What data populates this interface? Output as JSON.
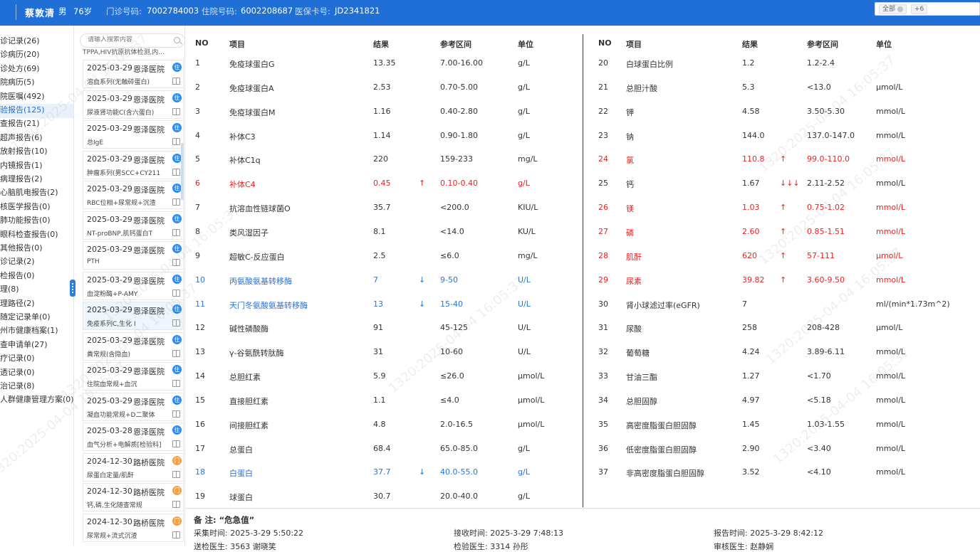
{
  "header": {
    "name": "蔡敦清",
    "gender": "男",
    "age": "76岁",
    "outpatient_label": "门诊号码:",
    "outpatient_no": "7002784003",
    "inpatient_label": "住院号码:",
    "inpatient_no": "6002208687",
    "insurance_label": "医保卡号:",
    "insurance_no": "JD2341821",
    "filter_chip": "全部",
    "filter_more": "+6"
  },
  "leftnav": [
    "诊记录(26)",
    "诊病历(20)",
    "诊处方(69)",
    "院病历(5)",
    "院医嘱(492)",
    "验报告(125)",
    "查报告(21)",
    "超声报告(6)",
    "放射报告(10)",
    "内镜报告(1)",
    "病理报告(2)",
    "心脑肌电报告(2)",
    "核医学报告(0)",
    "肺功能报告(0)",
    "眼科检查报告(0)",
    "其他报告(0)",
    "诊记录(2)",
    "检报告(0)",
    "理(8)",
    "理路径(2)",
    "随定记录单(0)",
    "州市健康档案(1)",
    "查申请单(27)",
    "疗记录(0)",
    "透记录(0)",
    "治记录(8)",
    "人群健康管理方案(0)"
  ],
  "search": {
    "placeholder": "请输入搜索内容"
  },
  "truncated_desc": "TPPA,HIV抗原抗体检测,内...",
  "records": [
    {
      "date": "2025-03-29",
      "hospital": "恩泽医院",
      "type": "住",
      "desc": "溶血系列(无触碎蛋白)"
    },
    {
      "date": "2025-03-29",
      "hospital": "恩泽医院",
      "type": "住",
      "desc": "尿液肾功能C(含六蛋白)"
    },
    {
      "date": "2025-03-29",
      "hospital": "恩泽医院",
      "type": "住",
      "desc": "总IgE"
    },
    {
      "date": "2025-03-29",
      "hospital": "恩泽医院",
      "type": "住",
      "desc": "肿瘤系列(男SCC+CY211"
    },
    {
      "date": "2025-03-29",
      "hospital": "恩泽医院",
      "type": "住",
      "desc": "RBC位相+尿常规+沉渣"
    },
    {
      "date": "2025-03-29",
      "hospital": "恩泽医院",
      "type": "住",
      "desc": "NT-proBNP,肌钙蛋白T"
    },
    {
      "date": "2025-03-29",
      "hospital": "恩泽医院",
      "type": "住",
      "desc": "PTH"
    },
    {
      "date": "2025-03-29",
      "hospital": "恩泽医院",
      "type": "住",
      "desc": "血淀粉酶+P-AMY"
    },
    {
      "date": "2025-03-29",
      "hospital": "恩泽医院",
      "type": "住",
      "desc": "免疫系列C,生化 I"
    },
    {
      "date": "2025-03-29",
      "hospital": "恩泽医院",
      "type": "住",
      "desc": "粪常规(含隐血)"
    },
    {
      "date": "2025-03-29",
      "hospital": "恩泽医院",
      "type": "住",
      "desc": "住院血常规+血沉"
    },
    {
      "date": "2025-03-29",
      "hospital": "恩泽医院",
      "type": "住",
      "desc": "凝血功能常规+D二聚体"
    },
    {
      "date": "2025-03-28",
      "hospital": "恩泽医院",
      "type": "住",
      "desc": "血气分析+电解质[检验科]"
    },
    {
      "date": "2024-12-30",
      "hospital": "路桥医院",
      "type": "门",
      "desc": "尿蛋白定量/肌酐"
    },
    {
      "date": "2024-12-30",
      "hospital": "路桥医院",
      "type": "门",
      "desc": "钙,磷,生化随查常规"
    },
    {
      "date": "2024-12-30",
      "hospital": "路桥医院",
      "type": "门",
      "desc": "尿常规+流式沉渣"
    }
  ],
  "table_headers": {
    "no": "NO",
    "item": "项目",
    "result": "结果",
    "range": "参考区间",
    "unit": "单位"
  },
  "left_rows": [
    {
      "no": "1",
      "item": "免疫球蛋白G",
      "result": "13.35",
      "flag": "",
      "range": "7.00-16.00",
      "unit": "g/L",
      "status": "normal"
    },
    {
      "no": "2",
      "item": "免疫球蛋白A",
      "result": "2.53",
      "flag": "",
      "range": "0.70-5.00",
      "unit": "g/L",
      "status": "normal"
    },
    {
      "no": "3",
      "item": "免疫球蛋白M",
      "result": "1.16",
      "flag": "",
      "range": "0.40-2.80",
      "unit": "g/L",
      "status": "normal"
    },
    {
      "no": "4",
      "item": "补体C3",
      "result": "1.14",
      "flag": "",
      "range": "0.90-1.80",
      "unit": "g/L",
      "status": "normal"
    },
    {
      "no": "5",
      "item": "补体C1q",
      "result": "220",
      "flag": "",
      "range": "159-233",
      "unit": "mg/L",
      "status": "normal"
    },
    {
      "no": "6",
      "item": "补体C4",
      "result": "0.45",
      "flag": "↑",
      "range": "0.10-0.40",
      "unit": "g/L",
      "status": "red"
    },
    {
      "no": "7",
      "item": "抗溶血性链球菌O",
      "result": "35.7",
      "flag": "",
      "range": "<200.0",
      "unit": "KIU/L",
      "status": "normal"
    },
    {
      "no": "8",
      "item": "类风湿因子",
      "result": "8.1",
      "flag": "",
      "range": "<14.0",
      "unit": "KU/L",
      "status": "normal"
    },
    {
      "no": "9",
      "item": "超敏C-反应蛋白",
      "result": "2.5",
      "flag": "",
      "range": "≤6.0",
      "unit": "mg/L",
      "status": "normal"
    },
    {
      "no": "10",
      "item": "丙氨酸氨基转移酶",
      "result": "7",
      "flag": "↓",
      "range": "9-50",
      "unit": "U/L",
      "status": "blue"
    },
    {
      "no": "11",
      "item": "天门冬氨酸氨基转移酶",
      "result": "13",
      "flag": "↓",
      "range": "15-40",
      "unit": "U/L",
      "status": "blue"
    },
    {
      "no": "12",
      "item": "碱性磷酸酶",
      "result": "91",
      "flag": "",
      "range": "45-125",
      "unit": "U/L",
      "status": "normal"
    },
    {
      "no": "13",
      "item": "γ-谷氨酰转肽酶",
      "result": "31",
      "flag": "",
      "range": "10-60",
      "unit": "U/L",
      "status": "normal"
    },
    {
      "no": "14",
      "item": "总胆红素",
      "result": "5.9",
      "flag": "",
      "range": "≤26.0",
      "unit": "μmol/L",
      "status": "normal"
    },
    {
      "no": "15",
      "item": "直接胆红素",
      "result": "1.1",
      "flag": "",
      "range": "≤4.0",
      "unit": "μmol/L",
      "status": "normal"
    },
    {
      "no": "16",
      "item": "间接胆红素",
      "result": "4.8",
      "flag": "",
      "range": "2.0-16.5",
      "unit": "μmol/L",
      "status": "normal"
    },
    {
      "no": "17",
      "item": "总蛋白",
      "result": "68.4",
      "flag": "",
      "range": "65.0-85.0",
      "unit": "g/L",
      "status": "normal"
    },
    {
      "no": "18",
      "item": "白蛋白",
      "result": "37.7",
      "flag": "↓",
      "range": "40.0-55.0",
      "unit": "g/L",
      "status": "blue"
    },
    {
      "no": "19",
      "item": "球蛋白",
      "result": "30.7",
      "flag": "",
      "range": "20.0-40.0",
      "unit": "g/L",
      "status": "normal"
    }
  ],
  "right_rows": [
    {
      "no": "20",
      "item": "白球蛋白比例",
      "result": "1.2",
      "flag": "",
      "range": "1.2-2.4",
      "unit": "",
      "status": "normal"
    },
    {
      "no": "21",
      "item": "总胆汁酸",
      "result": "5.3",
      "flag": "",
      "range": "<13.0",
      "unit": "μmol/L",
      "status": "normal"
    },
    {
      "no": "22",
      "item": "钾",
      "result": "4.58",
      "flag": "",
      "range": "3.50-5.30",
      "unit": "mmol/L",
      "status": "normal"
    },
    {
      "no": "23",
      "item": "钠",
      "result": "144.0",
      "flag": "",
      "range": "137.0-147.0",
      "unit": "mmol/L",
      "status": "normal"
    },
    {
      "no": "24",
      "item": "氯",
      "result": "110.8",
      "flag": "↑",
      "range": "99.0-110.0",
      "unit": "mmol/L",
      "status": "red"
    },
    {
      "no": "25",
      "item": "钙",
      "result": "1.67",
      "flag": "↓↓↓",
      "range": "2.11-2.52",
      "unit": "mmol/L",
      "status": "normal",
      "flag_red": true
    },
    {
      "no": "26",
      "item": "镁",
      "result": "1.03",
      "flag": "↑",
      "range": "0.75-1.02",
      "unit": "mmol/L",
      "status": "red"
    },
    {
      "no": "27",
      "item": "磷",
      "result": "2.60",
      "flag": "↑",
      "range": "0.85-1.51",
      "unit": "mmol/L",
      "status": "red"
    },
    {
      "no": "28",
      "item": "肌酐",
      "result": "620",
      "flag": "↑",
      "range": "57-111",
      "unit": "μmol/L",
      "status": "red"
    },
    {
      "no": "29",
      "item": "尿素",
      "result": "39.82",
      "flag": "↑",
      "range": "3.60-9.50",
      "unit": "mmol/L",
      "status": "red"
    },
    {
      "no": "30",
      "item": "肾小球滤过率(eGFR)",
      "result": "7",
      "flag": "",
      "range": "",
      "unit": "ml/(min*1.73m^2)",
      "status": "normal"
    },
    {
      "no": "31",
      "item": "尿酸",
      "result": "258",
      "flag": "",
      "range": "208-428",
      "unit": "μmol/L",
      "status": "normal"
    },
    {
      "no": "32",
      "item": "葡萄糖",
      "result": "4.24",
      "flag": "",
      "range": "3.89-6.11",
      "unit": "mmol/L",
      "status": "normal"
    },
    {
      "no": "33",
      "item": "甘油三酯",
      "result": "1.27",
      "flag": "",
      "range": "<1.70",
      "unit": "mmol/L",
      "status": "normal"
    },
    {
      "no": "34",
      "item": "总胆固醇",
      "result": "4.97",
      "flag": "",
      "range": "<5.18",
      "unit": "mmol/L",
      "status": "normal"
    },
    {
      "no": "35",
      "item": "高密度脂蛋白胆固醇",
      "result": "1.45",
      "flag": "",
      "range": "1.03-1.55",
      "unit": "mmol/L",
      "status": "normal"
    },
    {
      "no": "36",
      "item": "低密度脂蛋白胆固醇",
      "result": "2.90",
      "flag": "",
      "range": "<3.40",
      "unit": "mmol/L",
      "status": "normal"
    },
    {
      "no": "37",
      "item": "非高密度脂蛋白胆固醇",
      "result": "3.52",
      "flag": "",
      "range": "<4.10",
      "unit": "mmol/L",
      "status": "normal"
    }
  ],
  "footer": {
    "note": "备   注: “危急值”",
    "collect": "采集时间:  2025-3-29 5:50:22",
    "receive": "接收时间:  2025-3-29 7:48:13",
    "report": "报告时间:  2025-3-29 8:42:12",
    "doctor1": "送检医生:  3563 谢晓笑",
    "doctor2": "检验医生:  3314 孙彤",
    "doctor3": "审核医生:  赵静娴"
  },
  "watermark": "1320:2025-04-04 16:05:37",
  "colors": {
    "header": "#1f6fd6",
    "abnormal_high": "#f02020",
    "abnormal_low": "#2a73d9"
  }
}
